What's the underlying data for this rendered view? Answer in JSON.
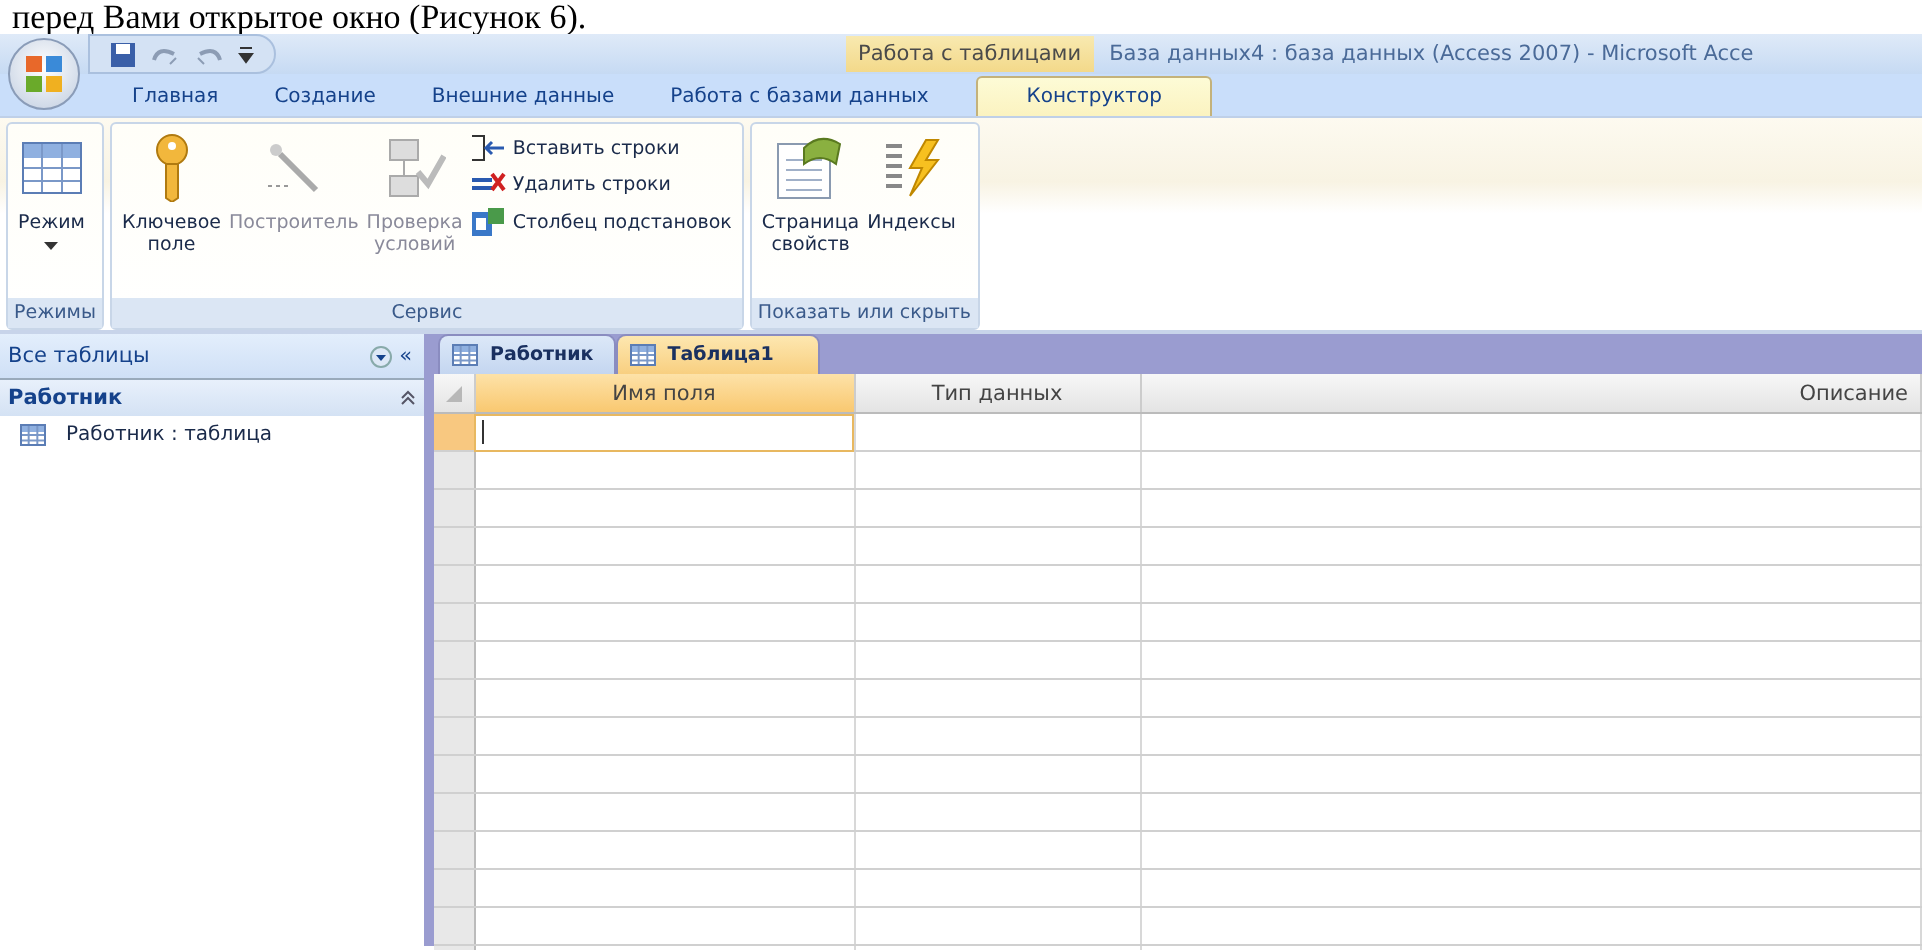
{
  "caption": "перед Вами открытое окно (Рисунок 6).",
  "title_bar": {
    "context_tab": "Работа с таблицами",
    "title": "База данных4 : база данных (Access 2007) - Microsoft Acce"
  },
  "ribbon_tabs": [
    {
      "label": "Главная",
      "selected": false
    },
    {
      "label": "Создание",
      "selected": false
    },
    {
      "label": "Внешние данные",
      "selected": false
    },
    {
      "label": "Работа с базами данных",
      "selected": false
    },
    {
      "label": "Конструктор",
      "selected": true
    }
  ],
  "ribbon_groups": [
    {
      "label": "Режимы",
      "items": [
        {
          "kind": "large",
          "label": "Режим",
          "dropdown": true,
          "disabled": false
        }
      ]
    },
    {
      "label": "Сервис",
      "items": [
        {
          "kind": "large",
          "label": "Ключевое поле",
          "disabled": false
        },
        {
          "kind": "large",
          "label": "Построитель",
          "disabled": true
        },
        {
          "kind": "large",
          "label": "Проверка условий",
          "disabled": true
        },
        {
          "kind": "small",
          "label": "Вставить строки",
          "disabled": false
        },
        {
          "kind": "small",
          "label": "Удалить строки",
          "disabled": false
        },
        {
          "kind": "small",
          "label": "Столбец подстановок",
          "disabled": false
        }
      ]
    },
    {
      "label": "Показать или скрыть",
      "items": [
        {
          "kind": "large",
          "label": "Страница свойств",
          "disabled": false
        },
        {
          "kind": "large",
          "label": "Индексы",
          "disabled": false
        }
      ]
    }
  ],
  "nav_pane": {
    "title": "Все таблицы",
    "collapse": "«",
    "group": {
      "label": "Работник",
      "expanded": true,
      "items": [
        "Работник : таблица"
      ]
    }
  },
  "doc_tabs": [
    {
      "label": "Работник",
      "selected": false
    },
    {
      "label": "Таблица1",
      "selected": true
    }
  ],
  "grid": {
    "columns": [
      "Имя поля",
      "Тип данных",
      "Описание"
    ],
    "rows": [
      {
        "selected": true
      },
      {
        "selected": false
      },
      {
        "selected": false
      },
      {
        "selected": false
      },
      {
        "selected": false
      },
      {
        "selected": false
      },
      {
        "selected": false
      },
      {
        "selected": false
      },
      {
        "selected": false
      },
      {
        "selected": false
      },
      {
        "selected": false
      },
      {
        "selected": false
      },
      {
        "selected": false
      },
      {
        "selected": false
      },
      {
        "selected": false
      }
    ]
  }
}
